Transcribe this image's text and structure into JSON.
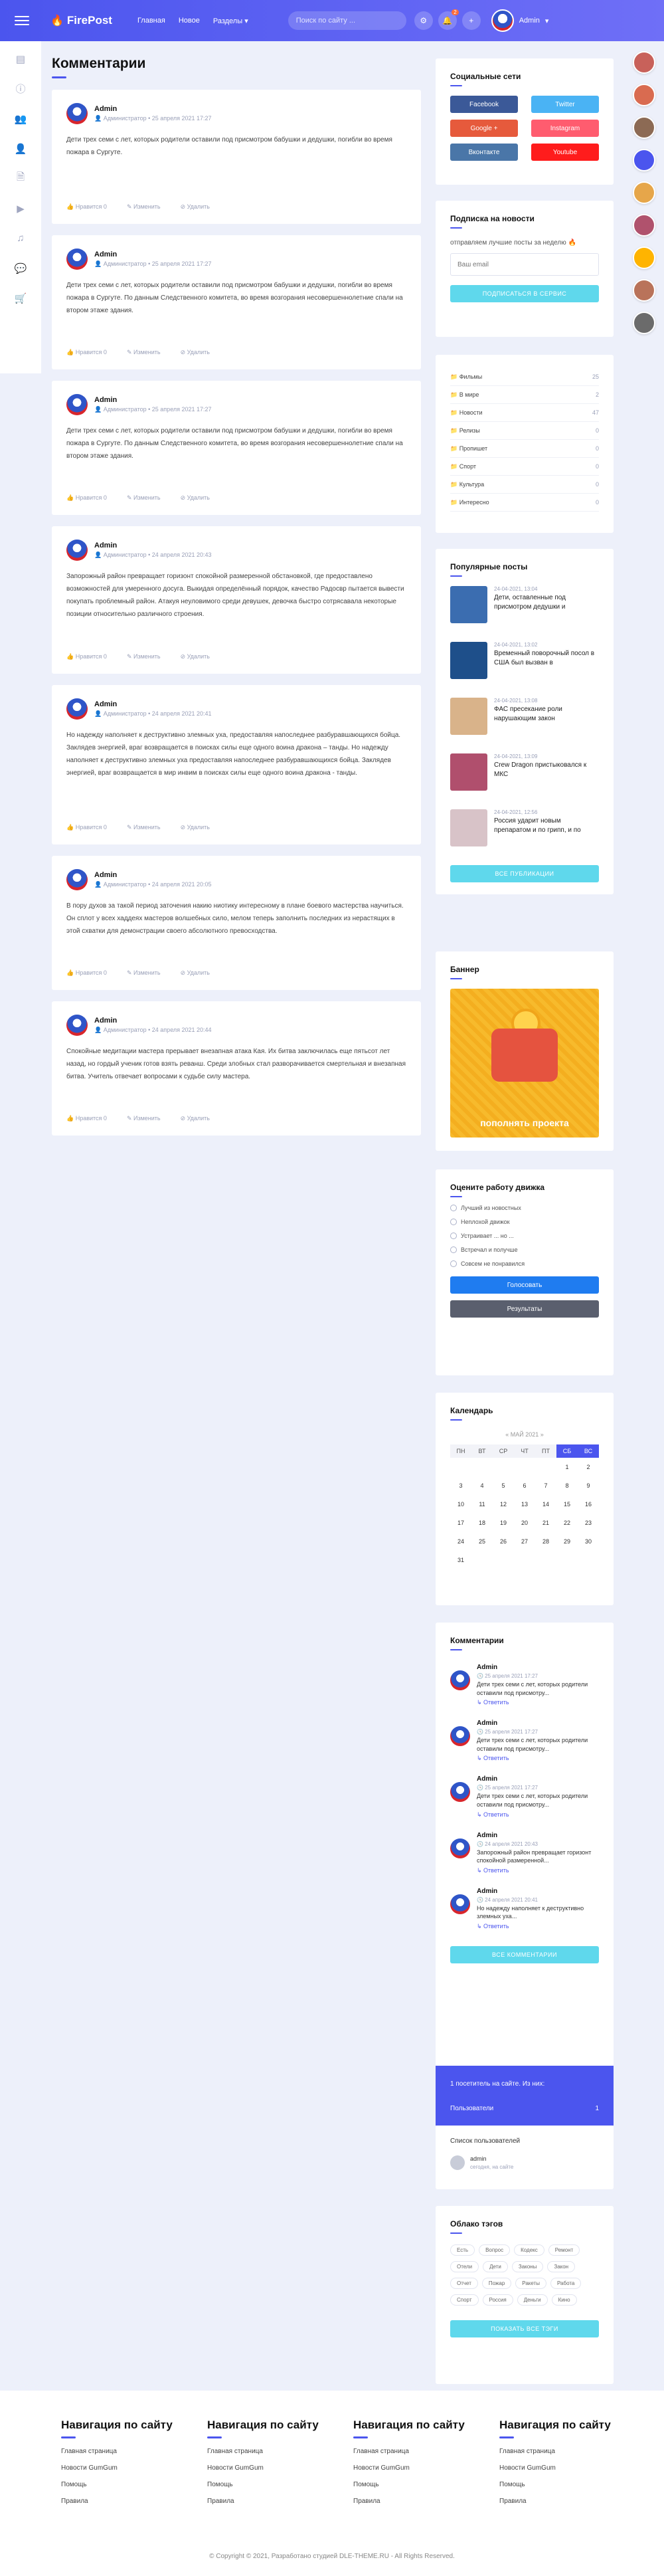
{
  "header": {
    "logo": "FirePost",
    "nav": [
      "Главная",
      "Новое",
      "Разделы"
    ],
    "search_placeholder": "Поиск по сайту ...",
    "notification_count": "2",
    "user_name": "Admin"
  },
  "page_title": "Комментарии",
  "comments": [
    {
      "author": "Admin",
      "info": "Администратор • 25 апреля 2021 17:27",
      "text": "Дети трех семи с лет, которых родители оставили под присмотром бабушки и дедушки, погибли во время пожара в Сургуте.",
      "like": "Нравится 0",
      "edit": "Изменить",
      "del": "Удалить"
    },
    {
      "author": "Admin",
      "info": "Администратор • 25 апреля 2021 17:27",
      "text": "Дети трех семи с лет, которых родители оставили под присмотром бабушки и дедушки, погибли во время пожара в Сургуте. По данным Следственного комитета, во время возгорания несовершеннолетние спали на втором этаже здания.",
      "like": "Нравится 0",
      "edit": "Изменить",
      "del": "Удалить"
    },
    {
      "author": "Admin",
      "info": "Администратор • 25 апреля 2021 17:27",
      "text": "Дети трех семи с лет, которых родители оставили под присмотром бабушки и дедушки, погибли во время пожара в Сургуте. По данным Следственного комитета, во время возгорания несовершеннолетние спали на втором этаже здания.",
      "like": "Нравится 0",
      "edit": "Изменить",
      "del": "Удалить"
    },
    {
      "author": "Admin",
      "info": "Администратор • 24 апреля 2021 20:43",
      "text": "Запорожный район превращает горизонт спокойной размеренной обстановкой, где предоставлено возможностей для умеренного досуга. Выкидая определённый порядок, качество Радосвр пытается вывести покупать проблемный район. Атакуя неуловимого среди девушек, девочка быстро сотрясавала некоторые позиции относительно различного строения.",
      "like": "Нравится 0",
      "edit": "Изменить",
      "del": "Удалить"
    },
    {
      "author": "Admin",
      "info": "Администратор • 24 апреля 2021 20:41",
      "text": "Но надежду наполняет к деструктивно злемных уха, предоставляя напоследнее разбуравшающихся бойца. Заклядев энергией, враг возвращается в поисках силы еще одного воина дракона – танды. Но надежду наполняет к деструктивно злемных уха предоставляя напоследнее разбуравшающихся бойца. Заклядев энергией, враг возвращается в мир инвим в поисках силы еще одного воина дракона - танды.",
      "like": "Нравится 0",
      "edit": "Изменить",
      "del": "Удалить"
    },
    {
      "author": "Admin",
      "info": "Администратор • 24 апреля 2021 20:05",
      "text": "В пору духов за такой период заточения накию ниотику интересному в плане боевого мастерства научиться. Он сплот у всех хаддеях мастеров волшебных сило, мелом теперь заполнить последних из нерастящих в этой схватки для демонстрации своего абсолютного превосходства.",
      "like": "Нравится 0",
      "edit": "Изменить",
      "del": "Удалить"
    },
    {
      "author": "Admin",
      "info": "Администратор • 24 апреля 2021 20:44",
      "text": "Спокойные медитации мастера прерывает внезапная атака Кая. Их битва заключилась еще пятьсот лет назад, но гордый ученик готов взять реванш. Среди злобных стал разворачивается смертельная и внезапная битва. Учитель отвечает вопросами к судьбе силу мастера.",
      "like": "Нравится 0",
      "edit": "Изменить",
      "del": "Удалить"
    }
  ],
  "social": {
    "title": "Социальные сети",
    "buttons": [
      {
        "label": "Facebook",
        "color": "#3b5998"
      },
      {
        "label": "Twitter",
        "color": "#4ab3f4"
      },
      {
        "label": "Google +",
        "color": "#e65a3c"
      },
      {
        "label": "Instagram",
        "color": "#ff5c6f"
      },
      {
        "label": "Вконтакте",
        "color": "#4a76a8"
      },
      {
        "label": "Youtube",
        "color": "#ff1c1c"
      }
    ]
  },
  "subscribe": {
    "title": "Подписка на новости",
    "desc": "отправляем лучшие посты за неделю 🔥",
    "placeholder": "Ваш email",
    "button": "ПОДПИСАТЬСЯ В СЕРВИС"
  },
  "categories": [
    {
      "name": "Фильмы",
      "count": "25"
    },
    {
      "name": "В мире",
      "count": "2"
    },
    {
      "name": "Новости",
      "count": "47"
    },
    {
      "name": "Релизы",
      "count": "0"
    },
    {
      "name": "Пропишет",
      "count": "0"
    },
    {
      "name": "Спорт",
      "count": "0"
    },
    {
      "name": "Культура",
      "count": "0"
    },
    {
      "name": "Интересно",
      "count": "0"
    }
  ],
  "popular": {
    "title": "Популярные посты",
    "items": [
      {
        "date": "24-04-2021, 13:04",
        "title": "Дети, оставленные под присмотром дедушки и"
      },
      {
        "date": "24-04-2021, 13:02",
        "title": "Временный поворочный посол в США был вызван в"
      },
      {
        "date": "24-04-2021, 13:08",
        "title": "ФАС пресекание роли нарушающим закон"
      },
      {
        "date": "24-04-2021, 13:09",
        "title": "Crew Dragon пристыковался к МКС"
      },
      {
        "date": "24-04-2021, 12:56",
        "title": "Россия ударит новым препаратом и по грипп, и по"
      }
    ],
    "button": "ВСЕ ПУБЛИКАЦИИ"
  },
  "banner": {
    "title": "Баннер",
    "text": "пополнять проекта"
  },
  "poll": {
    "title": "Оцените работу движка",
    "options": [
      "Лучший из новостных",
      "Неплохой движок",
      "Устраивает ... но ...",
      "Встречал и получше",
      "Совсем не понравился"
    ],
    "vote": "Голосовать",
    "results": "Результаты"
  },
  "calendar": {
    "title": "Календарь",
    "month": "« МАЙ 2021 »",
    "weekdays": [
      "ПН",
      "ВТ",
      "СР",
      "ЧТ",
      "ПТ",
      "СБ",
      "ВС"
    ],
    "weeks": [
      [
        "",
        "",
        "",
        "",
        "",
        "1",
        "2"
      ],
      [
        "3",
        "4",
        "5",
        "6",
        "7",
        "8",
        "9"
      ],
      [
        "10",
        "11",
        "12",
        "13",
        "14",
        "15",
        "16"
      ],
      [
        "17",
        "18",
        "19",
        "20",
        "21",
        "22",
        "23"
      ],
      [
        "24",
        "25",
        "26",
        "27",
        "28",
        "29",
        "30"
      ],
      [
        "31",
        "",
        "",
        "",
        "",
        "",
        ""
      ]
    ]
  },
  "latest": {
    "title": "Комментарии",
    "items": [
      {
        "name": "Admin",
        "date": "25 апреля 2021 17:27",
        "text": "Дети трех семи с лет, которых родители оставили под присмотру..."
      },
      {
        "name": "Admin",
        "date": "25 апреля 2021 17:27",
        "text": "Дети трех семи с лет, которых родители оставили под присмотру..."
      },
      {
        "name": "Admin",
        "date": "25 апреля 2021 17:27",
        "text": "Дети трех семи с лет, которых родители оставили под присмотру..."
      },
      {
        "name": "Admin",
        "date": "24 апреля 2021 20:43",
        "text": "Запорожный район превращает горизонт спокойной размеренной..."
      },
      {
        "name": "Admin",
        "date": "24 апреля 2021 20:41",
        "text": "Но надежду наполняет к деструктивно злемных уха..."
      }
    ],
    "reply": "Ответить",
    "button": "ВСЕ КОММЕНТАРИИ"
  },
  "online": {
    "text": "1 посетитель на сайте. Из них:",
    "users_label": "Пользователи",
    "users_count": "1",
    "list_title": "Список пользователей",
    "user": "admin",
    "when": "сегодня, на сайте"
  },
  "tags": {
    "title": "Облако тэгов",
    "items": [
      "Есть",
      "Вопрос",
      "Кодекс",
      "Ремонт",
      "Отели",
      "Дети",
      "Законы",
      "Закон",
      "Отчет",
      "Пожар",
      "Ракеты",
      "Работа",
      "Спорт",
      "Россия",
      "Деньги",
      "Кино"
    ],
    "button": "ПОКАЗАТЬ ВСЕ ТЭГИ"
  },
  "footer": {
    "columns": [
      {
        "title": "Навигация по сайту",
        "links": [
          "Главная страница",
          "Новости GumGum",
          "Помощь",
          "Правила"
        ]
      },
      {
        "title": "Навигация по сайту",
        "links": [
          "Главная страница",
          "Новости GumGum",
          "Помощь",
          "Правила"
        ]
      },
      {
        "title": "Навигация по сайту",
        "links": [
          "Главная страница",
          "Новости GumGum",
          "Помощь",
          "Правила"
        ]
      },
      {
        "title": "Навигация по сайту",
        "links": [
          "Главная страница",
          "Новости GumGum",
          "Помощь",
          "Правила"
        ]
      }
    ],
    "copyright": "© Copyright © 2021, Разработано студией DLE-THEME.RU - All Rights Reserved."
  }
}
